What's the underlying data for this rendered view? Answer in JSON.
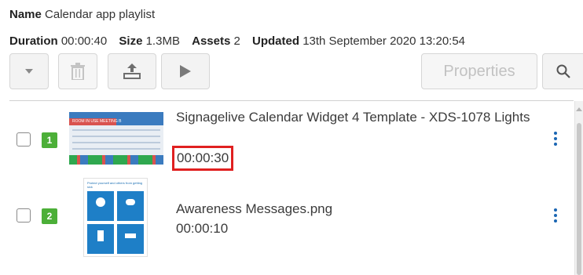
{
  "playlist": {
    "name_label": "Name",
    "name_value": "Calendar app playlist",
    "duration_label": "Duration",
    "duration_value": "00:00:40",
    "size_label": "Size",
    "size_value": "1.3MB",
    "assets_label": "Assets",
    "assets_value": "2",
    "updated_label": "Updated",
    "updated_value": "13th September 2020 13:20:54"
  },
  "toolbar": {
    "dropdown_icon": "caret-down-icon",
    "delete_icon": "trash-icon",
    "export_icon": "export-icon",
    "play_icon": "play-icon",
    "properties_label": "Properties",
    "search_icon": "search-icon"
  },
  "items": [
    {
      "number": "1",
      "title": "Signagelive Calendar Widget 4 Template - XDS-1078 Lights",
      "duration": "00:00:30",
      "thumbnail_icon": "calendar-widget-thumbnail",
      "thumbnail_text": "ROOM IN USE    MEETING B"
    },
    {
      "number": "2",
      "title": "Awareness Messages.png",
      "duration": "00:00:10",
      "thumbnail_icon": "awareness-poster-thumbnail",
      "thumbnail_text": "Protect yourself and others from getting sick"
    }
  ],
  "colors": {
    "badge": "#4caf38",
    "kebab": "#1a66b3",
    "highlight": "#e02020"
  }
}
